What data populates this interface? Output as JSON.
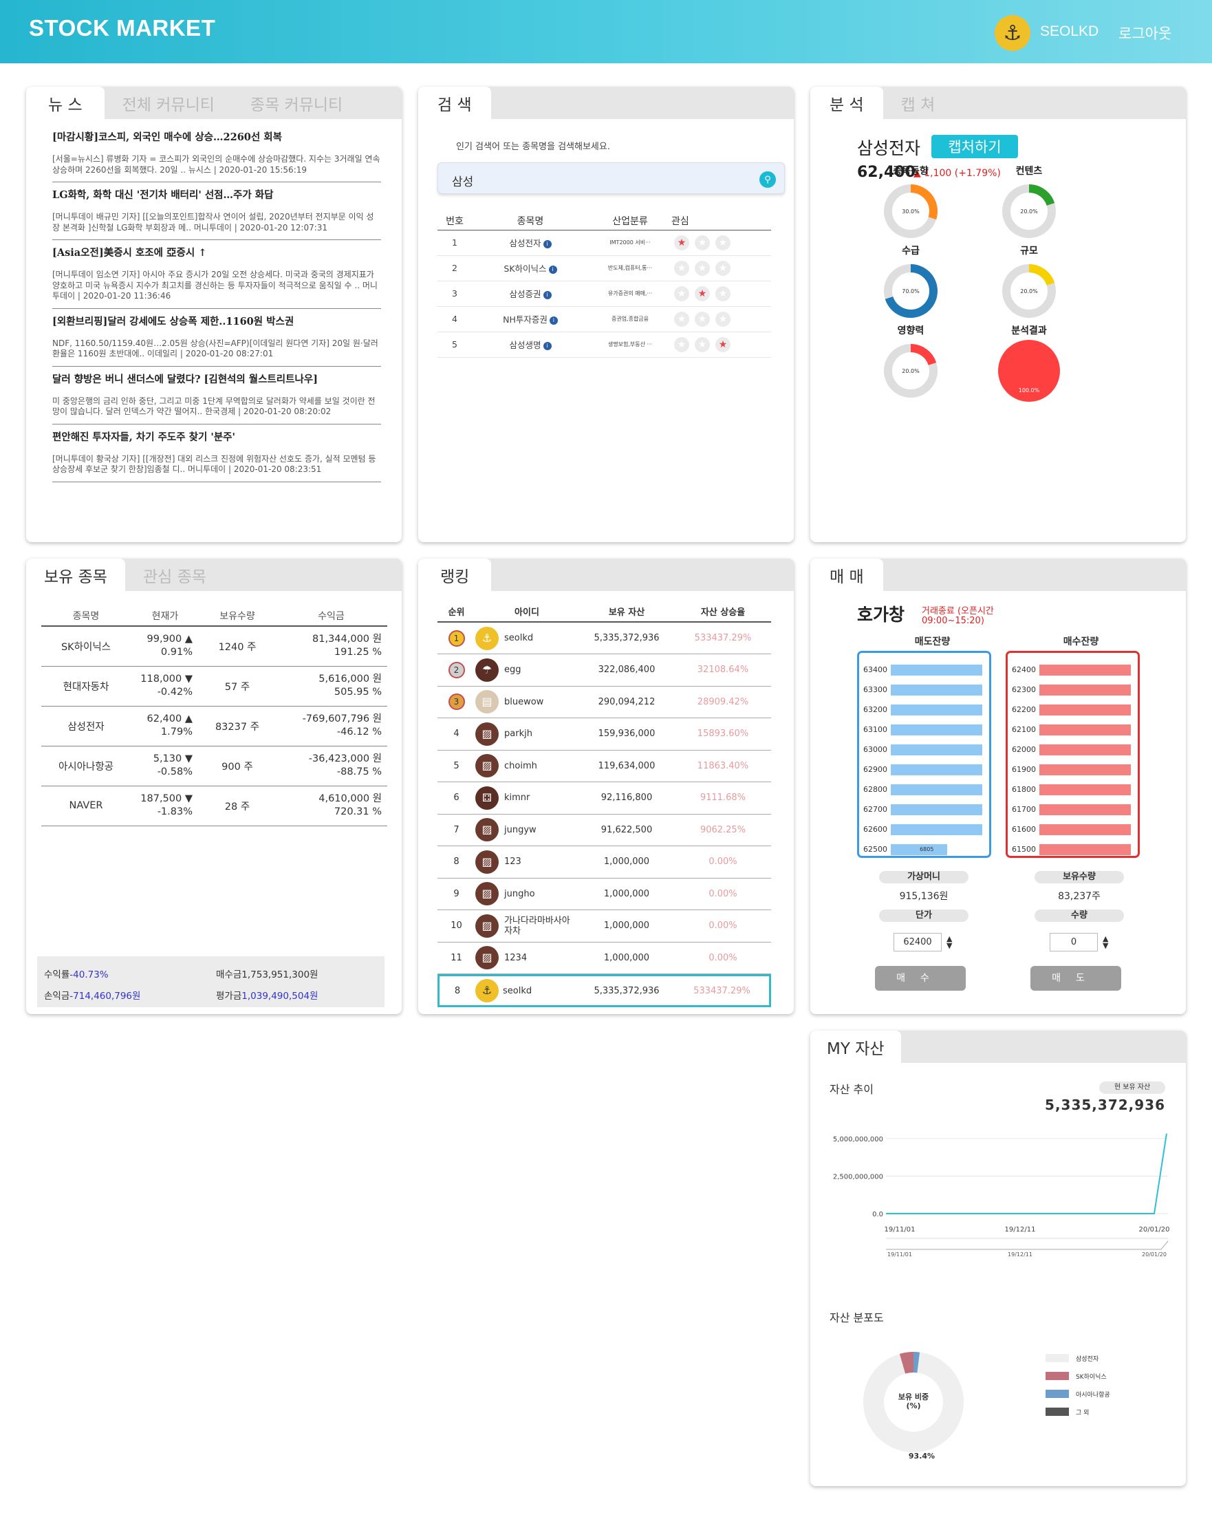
{
  "header": {
    "logo": "STOCK MARKET",
    "username": "SEOLKD",
    "logout": "로그아웃"
  },
  "news": {
    "tabs": [
      "뉴 스",
      "전체 커뮤니티",
      "종목 커뮤니티"
    ],
    "items": [
      {
        "title": "[마감시황]코스피, 외국인 매수에 상승…2260선 회복",
        "body": "[서울=뉴시스] 류병화 기자 = 코스피가 외국인의 순매수에 상승마감했다. 지수는 3거래일 연속 상승하며 2260선을 회복했다. 20일 .. 뉴시스 | 2020-01-20 15:56:19"
      },
      {
        "title": "LG화학, 화학 대신 '전기차 배터리' 선점…주가 화답",
        "body": "[머니투데이 배규민 기자] [[오늘의포인트]합작사 연이어 설립, 2020년부터 전지부문 이익 성장 본격화 ]신학철 LG화학 부회장과 메.. 머니투데이 | 2020-01-20 12:07:31"
      },
      {
        "title": "[Asia오전]美증시 호조에 亞증시 ↑",
        "body": "[머니투데이 임소연 기자] 아시아 주요 증시가 20일 오전 상승세다. 미국과 중국의 경제지표가 양호하고 미국 뉴욕증시 지수가 최고치를 경신하는 등 투자자들이 적극적으로 움직일 수 .. 머니투데이 | 2020-01-20 11:36:46"
      },
      {
        "title": "[외환브리핑]달러 강세에도 상승폭 제한..1160원 박스권",
        "body": "NDF, 1160.50/1159.40원…2.05원 상승(사진=AFP)[이데일리 원다연 기자] 20일 원·달러 환율은 1160원 초반대에.. 이데일리 | 2020-01-20 08:27:01"
      },
      {
        "title": "달러 향방은 버니 샌더스에 달렸다? [김현석의 월스트리트나우]",
        "body": "미 중앙은행의 금리 인하 중단, 그리고 미중 1단계 무역합의로 달러화가 약세를 보일 것이란 전망이 많습니다. 달러 인덱스가 약간 떨어지.. 한국경제 | 2020-01-20 08:20:02"
      },
      {
        "title": "편안해진 투자자들, 차기 주도주 찾기 '분주'",
        "body": "[머니투데이 황국상 기자] [[개장전] 대외 리스크 진정에 위험자산 선호도 증가, 실적 모멘텀 등 상승장세 후보군 찾기 한창]임종철 디.. 머니투데이 | 2020-01-20 08:23:51"
      }
    ]
  },
  "search": {
    "tab": "검 색",
    "hint": "인기 검색어 또는 종목명을 검색해보세요.",
    "query": "삼성",
    "columns": [
      "번호",
      "종목명",
      "산업분류",
      "관심"
    ],
    "rows": [
      {
        "no": "1",
        "name": "삼성전자",
        "industry": "IMT2000 서비···",
        "stars": [
          true,
          false,
          false
        ]
      },
      {
        "no": "2",
        "name": "SK하이닉스",
        "industry": "반도체,컴퓨터,통···",
        "stars": [
          false,
          false,
          false
        ]
      },
      {
        "no": "3",
        "name": "삼성증권",
        "industry": "유가증권의 매매,···",
        "stars": [
          false,
          true,
          false
        ]
      },
      {
        "no": "4",
        "name": "NH투자증권",
        "industry": "증권업,종합금융",
        "stars": [
          false,
          false,
          false
        ]
      },
      {
        "no": "5",
        "name": "삼성생명",
        "industry": "생명보험,부동산 ···",
        "stars": [
          false,
          false,
          true
        ]
      }
    ]
  },
  "analysis": {
    "tabs": [
      "분 석",
      "캡 쳐"
    ],
    "stock": "삼성전자",
    "capture_btn": "캡처하기",
    "price": "62,400",
    "change": "▲ 1,100  (+1.79%)",
    "donuts": [
      {
        "label": "종목동향",
        "value": 30.0,
        "text": "30.0%",
        "color": "#ff8a1e"
      },
      {
        "label": "컨텐츠",
        "value": 20.0,
        "text": "20.0%",
        "color": "#2ca02c"
      },
      {
        "label": "수급",
        "value": 70.0,
        "text": "70.0%",
        "color": "#1f77b4"
      },
      {
        "label": "규모",
        "value": 20.0,
        "text": "20.0%",
        "color": "#f7d000"
      },
      {
        "label": "영향력",
        "value": 20.0,
        "text": "20.0%",
        "color": "#ff4040"
      },
      {
        "label": "분석결과",
        "value": 100.0,
        "text": "100.0%",
        "color": "#ff4040"
      }
    ]
  },
  "holdings": {
    "tabs": [
      "보유 종목",
      "관심 종목"
    ],
    "columns": [
      "종목명",
      "현재가",
      "보유수량",
      "수익금"
    ],
    "rows": [
      {
        "name": "SK하이닉스",
        "price": "99,900 ▲",
        "pct": "0.91%",
        "qty": "1240 주",
        "profit": "81,344,000 원",
        "rate": "191.25 %",
        "up": true,
        "pup": true
      },
      {
        "name": "현대자동차",
        "price": "118,000 ▼",
        "pct": "-0.42%",
        "qty": "57 주",
        "profit": "5,616,000 원",
        "rate": "505.95 %",
        "up": false,
        "pup": false
      },
      {
        "name": "삼성전자",
        "price": "62,400 ▲",
        "pct": "1.79%",
        "qty": "83237 주",
        "profit": "-769,607,796 원",
        "rate": "-46.12 %",
        "up": true,
        "pup": true
      },
      {
        "name": "아시아나항공",
        "price": "5,130 ▼",
        "pct": "-0.58%",
        "qty": "900 주",
        "profit": "-36,423,000 원",
        "rate": "-88.75 %",
        "up": false,
        "pup": false
      },
      {
        "name": "NAVER",
        "price": "187,500 ▼",
        "pct": "-1.83%",
        "qty": "28 주",
        "profit": "4,610,000 원",
        "rate": "720.31 %",
        "up": false,
        "pup": false
      }
    ],
    "summary": {
      "rate_label": "수익률",
      "rate": "-40.73%",
      "buy_label": "매수금",
      "buy": "1,753,951,300원",
      "profit_label": "손익금",
      "profit": "-714,460,796원",
      "eval_label": "평가금",
      "eval": "1,039,490,504원"
    }
  },
  "ranking": {
    "tab": "랭킹",
    "columns": [
      "순위",
      "아이디",
      "보유 자산",
      "자산 상승율"
    ],
    "rows": [
      {
        "rank": "1",
        "id": "seolkd",
        "asset": "5,335,372,936",
        "rate": "533437.29%",
        "av": "anchor"
      },
      {
        "rank": "2",
        "id": "egg",
        "asset": "322,086,400",
        "rate": "32108.64%",
        "av": "umbrella"
      },
      {
        "rank": "3",
        "id": "bluewow",
        "asset": "290,094,212",
        "rate": "28909.42%",
        "av": "book"
      },
      {
        "rank": "4",
        "id": "parkjh",
        "asset": "159,936,000",
        "rate": "15893.60%",
        "av": "picture"
      },
      {
        "rank": "5",
        "id": "choimh",
        "asset": "119,634,000",
        "rate": "11863.40%",
        "av": "picture"
      },
      {
        "rank": "6",
        "id": "kimnr",
        "asset": "92,116,800",
        "rate": "9111.68%",
        "av": "dice"
      },
      {
        "rank": "7",
        "id": "jungyw",
        "asset": "91,622,500",
        "rate": "9062.25%",
        "av": "picture"
      },
      {
        "rank": "8",
        "id": "123",
        "asset": "1,000,000",
        "rate": "0.00%",
        "av": "picture"
      },
      {
        "rank": "9",
        "id": "jungho",
        "asset": "1,000,000",
        "rate": "0.00%",
        "av": "picture"
      },
      {
        "rank": "10",
        "id": "가나다라마바사아자차",
        "asset": "1,000,000",
        "rate": "0.00%",
        "av": "picture"
      },
      {
        "rank": "11",
        "id": "1234",
        "asset": "1,000,000",
        "rate": "0.00%",
        "av": "picture"
      }
    ],
    "my": {
      "rank": "8",
      "id": "seolkd",
      "asset": "5,335,372,936",
      "rate": "533437.29%"
    }
  },
  "trade": {
    "tab": "매 매",
    "title": "호가창",
    "status": "거래종료 (오픈시간",
    "hours": "09:00~15:20)",
    "sell_label": "매도잔량",
    "buy_label": "매수잔량",
    "sell_prices": [
      "63400",
      "63300",
      "63200",
      "63100",
      "63000",
      "62900",
      "62800",
      "62700",
      "62600",
      "62500"
    ],
    "sell_qty_last": "6805",
    "sell_fill_last": 0.62,
    "buy_prices": [
      "62400",
      "62300",
      "62200",
      "62100",
      "62000",
      "61900",
      "61800",
      "61700",
      "61600",
      "61500"
    ],
    "money_label": "가상머니",
    "money": "915,136원",
    "hold_label": "보유수량",
    "hold": "83,237주",
    "price_label": "단가",
    "price_val": "62400",
    "qty_label": "수량",
    "qty_val": "0",
    "buy_btn": "매수",
    "sell_btn": "매도"
  },
  "asset": {
    "tab": "MY 자산",
    "trend_title": "자산 추이",
    "current_label": "현 보유 자산",
    "current": "5,335,372,936",
    "dist_title": "자산 분포도",
    "donut_center": "보유 비중\n(%)",
    "donut_value": "93.4%",
    "legend": [
      {
        "name": "삼성전자",
        "color": "#efefef"
      },
      {
        "name": "SK하이닉스",
        "color": "#c0707a"
      },
      {
        "name": "아시아나항공",
        "color": "#6d9ec9"
      },
      {
        "name": "그 외",
        "color": "#555555"
      }
    ]
  },
  "chart_data": {
    "type": "line",
    "x": [
      "19/11/01",
      "19/12/11",
      "20/01/20"
    ],
    "series": [
      {
        "values": [
          0,
          0,
          5335372936
        ]
      }
    ],
    "yticks": [
      "5,000,000,000",
      "2,500,000,000",
      "0.0"
    ],
    "ylim": [
      0,
      5500000000
    ]
  }
}
